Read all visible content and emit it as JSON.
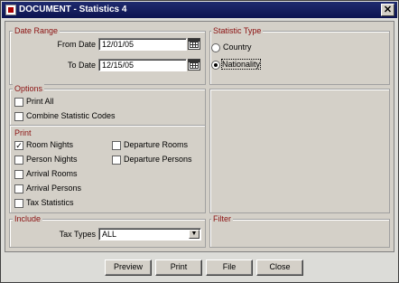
{
  "window": {
    "title": "DOCUMENT - Statistics 4",
    "close_glyph": "✕"
  },
  "date_range": {
    "heading": "Date Range",
    "from_label": "From Date",
    "from_value": "12/01/05",
    "to_label": "To Date",
    "to_value": "12/15/05"
  },
  "statistic_type": {
    "heading": "Statistic Type",
    "options": [
      {
        "label": "Country",
        "selected": false
      },
      {
        "label": "Nationality",
        "selected": true
      }
    ]
  },
  "options": {
    "heading": "Options",
    "items": [
      {
        "label": "Print All",
        "checked": false
      },
      {
        "label": "Combine Statistic Codes",
        "checked": false
      }
    ]
  },
  "print": {
    "heading": "Print",
    "left": [
      {
        "label": "Room Nights",
        "checked": true
      },
      {
        "label": "Person Nights",
        "checked": false
      },
      {
        "label": "Arrival Rooms",
        "checked": false
      },
      {
        "label": "Arrival Persons",
        "checked": false
      },
      {
        "label": "Tax Statistics",
        "checked": false
      }
    ],
    "right": [
      {
        "label": "Departure Rooms",
        "checked": false
      },
      {
        "label": "Departure Persons",
        "checked": false
      }
    ]
  },
  "include": {
    "heading": "Include",
    "tax_types_label": "Tax Types",
    "tax_types_value": "ALL"
  },
  "filter": {
    "heading": "Filter"
  },
  "buttons": {
    "preview": "Preview",
    "print": "Print",
    "file": "File",
    "close": "Close"
  },
  "check_glyph": "✓",
  "dropdown_glyph": "▼"
}
